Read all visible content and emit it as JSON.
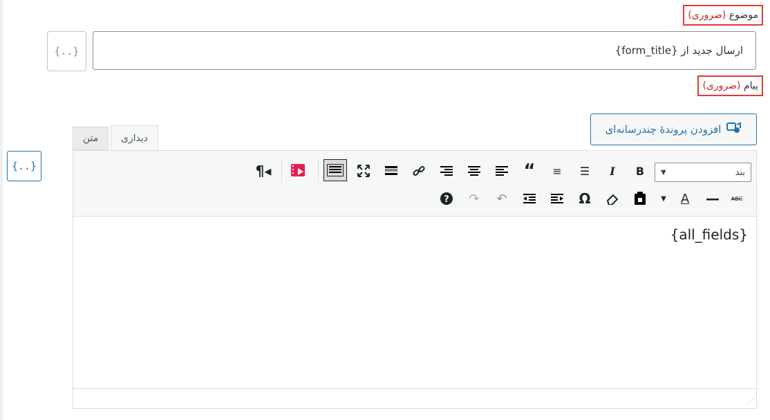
{
  "subject": {
    "label": "موضوع",
    "required": "(ضروری)",
    "value": "ارسال جدید از {form_title}",
    "tag_button": "{..}"
  },
  "message": {
    "label": "پیام",
    "required": "(ضروری)",
    "tag_button": "{..}",
    "add_media_label": "افزودن پروندهٔ چندرسانه‌ای",
    "tabs": [
      "دیداری",
      "متن"
    ],
    "format_select": "بند",
    "content": "{all_fields}"
  }
}
